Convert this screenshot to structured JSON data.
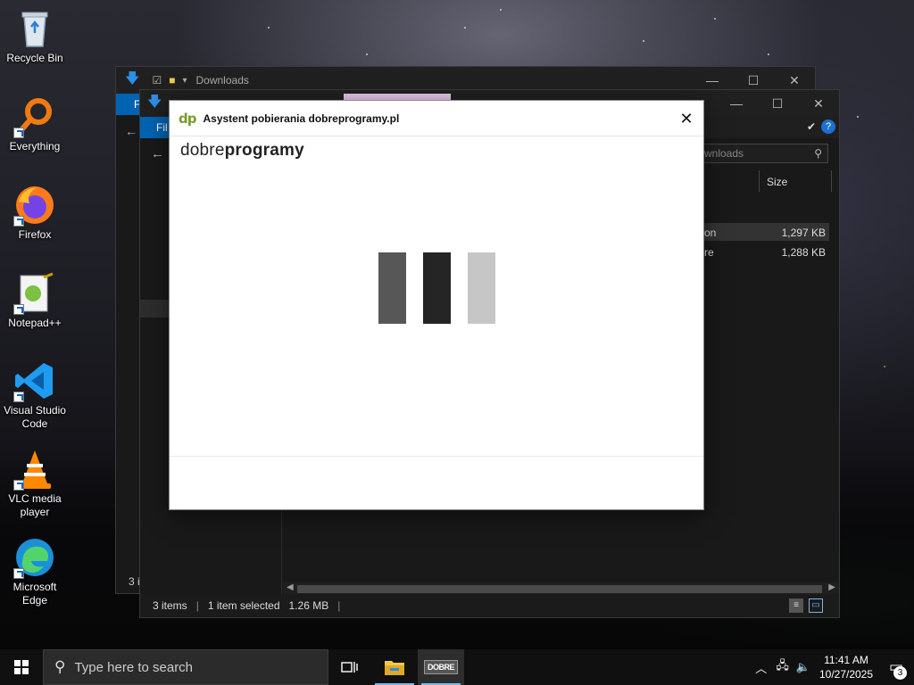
{
  "desktop": {
    "icons": [
      {
        "label": "Recycle Bin"
      },
      {
        "label": "Everything"
      },
      {
        "label": "Firefox"
      },
      {
        "label": "Notepad++"
      },
      {
        "label": "Visual Studio Code"
      },
      {
        "label": "VLC media player"
      },
      {
        "label": "Microsoft Edge"
      }
    ]
  },
  "explorer_back": {
    "title": "Downloads",
    "status_fragment": "3 i"
  },
  "explorer_front": {
    "file_tab": "File",
    "search_placeholder": "Search Downloads",
    "search_visible": "wnloads",
    "columns": {
      "size": "Size"
    },
    "rows": [
      {
        "name_fragment": "on",
        "size": "1,297 KB"
      },
      {
        "name_fragment": "re",
        "size": "1,288 KB"
      }
    ],
    "status": {
      "items": "3 items",
      "selected": "1 item selected",
      "size": "1.26 MB"
    }
  },
  "dialog": {
    "logo": "dp",
    "title": "Asystent pobierania dobreprogramy.pl",
    "brand_light": "dobre",
    "brand_bold": "programy",
    "loader_colors": [
      "#575757",
      "#252525",
      "#c6c6c6"
    ]
  },
  "taskbar": {
    "search_placeholder": "Type here to search",
    "time": "11:41 AM",
    "date": "10/27/2025",
    "notification_count": "3",
    "app_label": "DOBRE"
  },
  "colors": {
    "accent": "#0063b1",
    "taskbar": "#101010"
  }
}
